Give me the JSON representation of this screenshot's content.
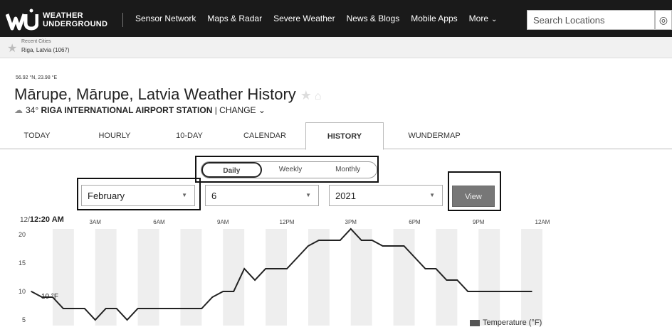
{
  "nav": {
    "logo_line1": "WEATHER",
    "logo_line2": "UNDERGROUND",
    "items": [
      "Sensor Network",
      "Maps & Radar",
      "Severe Weather",
      "News & Blogs",
      "Mobile Apps",
      "More"
    ],
    "search_placeholder": "Search Locations",
    "locate_icon": "crosshair-icon"
  },
  "recent": {
    "label": "Recent Cities",
    "city": "Riga, Latvia (1067)"
  },
  "location": {
    "coords": "56.92 °N, 23.98 °E",
    "title": "Mārupe, Mārupe, Latvia Weather History",
    "temp": "34°",
    "station": "RIGA INTERNATIONAL AIRPORT STATION",
    "change": "| CHANGE"
  },
  "tabs": [
    "TODAY",
    "HOURLY",
    "10-DAY",
    "CALENDAR",
    "HISTORY",
    "WUNDERMAP"
  ],
  "active_tab": "HISTORY",
  "period": {
    "options": [
      "Daily",
      "Weekly",
      "Monthly"
    ],
    "selected": "Daily"
  },
  "selectors": {
    "month": "February",
    "day": "6",
    "year": "2021",
    "view_label": "View"
  },
  "chart_data": {
    "type": "line",
    "date_prefix": "12/",
    "start_time": "12:20 AM",
    "x_tick_labels": [
      "3AM",
      "6AM",
      "9AM",
      "12PM",
      "3PM",
      "6PM",
      "9PM",
      "12AM"
    ],
    "y_ticks": [
      5,
      10,
      15,
      20
    ],
    "ylim": [
      4,
      21
    ],
    "xlim": [
      0,
      24
    ],
    "current_label": "10 °F",
    "series": [
      {
        "name": "Temperature (°F)",
        "color": "#222222",
        "x": [
          0,
          0.5,
          1.0,
          1.5,
          2.0,
          2.5,
          3.0,
          3.5,
          4.0,
          4.5,
          5.0,
          5.5,
          6.0,
          6.5,
          7.0,
          7.5,
          8.0,
          8.5,
          9.0,
          9.5,
          10.0,
          10.5,
          11.0,
          11.5,
          12.0,
          12.5,
          13.0,
          13.5,
          14.0,
          14.5,
          15.0,
          15.5,
          16.0,
          16.5,
          17.0,
          17.5,
          18.0,
          18.5,
          19.0,
          19.5,
          20.0,
          20.5,
          21.0,
          21.5,
          22.0,
          22.5,
          23.0,
          23.5
        ],
        "values": [
          10,
          9,
          9,
          7,
          7,
          7,
          5,
          7,
          7,
          5,
          7,
          7,
          7,
          7,
          7,
          7,
          7,
          9,
          10,
          10,
          14,
          12,
          14,
          14,
          14,
          16,
          18,
          19,
          19,
          19,
          21,
          19,
          19,
          18,
          18,
          18,
          16,
          14,
          14,
          12,
          12,
          10,
          10,
          10,
          10,
          10,
          10,
          10
        ]
      }
    ],
    "legend": "Temperature (°F)",
    "grid": true
  }
}
